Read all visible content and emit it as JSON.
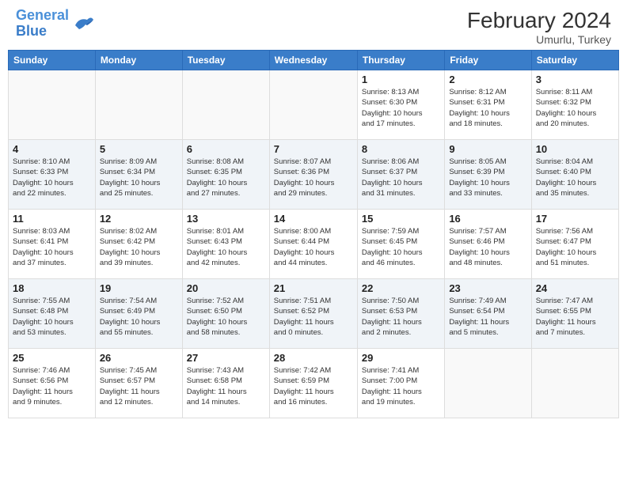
{
  "header": {
    "logo_line1": "General",
    "logo_line2": "Blue",
    "month": "February 2024",
    "location": "Umurlu, Turkey"
  },
  "days_of_week": [
    "Sunday",
    "Monday",
    "Tuesday",
    "Wednesday",
    "Thursday",
    "Friday",
    "Saturday"
  ],
  "weeks": [
    {
      "shaded": false,
      "days": [
        {
          "num": "",
          "info": ""
        },
        {
          "num": "",
          "info": ""
        },
        {
          "num": "",
          "info": ""
        },
        {
          "num": "",
          "info": ""
        },
        {
          "num": "1",
          "info": "Sunrise: 8:13 AM\nSunset: 6:30 PM\nDaylight: 10 hours\nand 17 minutes."
        },
        {
          "num": "2",
          "info": "Sunrise: 8:12 AM\nSunset: 6:31 PM\nDaylight: 10 hours\nand 18 minutes."
        },
        {
          "num": "3",
          "info": "Sunrise: 8:11 AM\nSunset: 6:32 PM\nDaylight: 10 hours\nand 20 minutes."
        }
      ]
    },
    {
      "shaded": true,
      "days": [
        {
          "num": "4",
          "info": "Sunrise: 8:10 AM\nSunset: 6:33 PM\nDaylight: 10 hours\nand 22 minutes."
        },
        {
          "num": "5",
          "info": "Sunrise: 8:09 AM\nSunset: 6:34 PM\nDaylight: 10 hours\nand 25 minutes."
        },
        {
          "num": "6",
          "info": "Sunrise: 8:08 AM\nSunset: 6:35 PM\nDaylight: 10 hours\nand 27 minutes."
        },
        {
          "num": "7",
          "info": "Sunrise: 8:07 AM\nSunset: 6:36 PM\nDaylight: 10 hours\nand 29 minutes."
        },
        {
          "num": "8",
          "info": "Sunrise: 8:06 AM\nSunset: 6:37 PM\nDaylight: 10 hours\nand 31 minutes."
        },
        {
          "num": "9",
          "info": "Sunrise: 8:05 AM\nSunset: 6:39 PM\nDaylight: 10 hours\nand 33 minutes."
        },
        {
          "num": "10",
          "info": "Sunrise: 8:04 AM\nSunset: 6:40 PM\nDaylight: 10 hours\nand 35 minutes."
        }
      ]
    },
    {
      "shaded": false,
      "days": [
        {
          "num": "11",
          "info": "Sunrise: 8:03 AM\nSunset: 6:41 PM\nDaylight: 10 hours\nand 37 minutes."
        },
        {
          "num": "12",
          "info": "Sunrise: 8:02 AM\nSunset: 6:42 PM\nDaylight: 10 hours\nand 39 minutes."
        },
        {
          "num": "13",
          "info": "Sunrise: 8:01 AM\nSunset: 6:43 PM\nDaylight: 10 hours\nand 42 minutes."
        },
        {
          "num": "14",
          "info": "Sunrise: 8:00 AM\nSunset: 6:44 PM\nDaylight: 10 hours\nand 44 minutes."
        },
        {
          "num": "15",
          "info": "Sunrise: 7:59 AM\nSunset: 6:45 PM\nDaylight: 10 hours\nand 46 minutes."
        },
        {
          "num": "16",
          "info": "Sunrise: 7:57 AM\nSunset: 6:46 PM\nDaylight: 10 hours\nand 48 minutes."
        },
        {
          "num": "17",
          "info": "Sunrise: 7:56 AM\nSunset: 6:47 PM\nDaylight: 10 hours\nand 51 minutes."
        }
      ]
    },
    {
      "shaded": true,
      "days": [
        {
          "num": "18",
          "info": "Sunrise: 7:55 AM\nSunset: 6:48 PM\nDaylight: 10 hours\nand 53 minutes."
        },
        {
          "num": "19",
          "info": "Sunrise: 7:54 AM\nSunset: 6:49 PM\nDaylight: 10 hours\nand 55 minutes."
        },
        {
          "num": "20",
          "info": "Sunrise: 7:52 AM\nSunset: 6:50 PM\nDaylight: 10 hours\nand 58 minutes."
        },
        {
          "num": "21",
          "info": "Sunrise: 7:51 AM\nSunset: 6:52 PM\nDaylight: 11 hours\nand 0 minutes."
        },
        {
          "num": "22",
          "info": "Sunrise: 7:50 AM\nSunset: 6:53 PM\nDaylight: 11 hours\nand 2 minutes."
        },
        {
          "num": "23",
          "info": "Sunrise: 7:49 AM\nSunset: 6:54 PM\nDaylight: 11 hours\nand 5 minutes."
        },
        {
          "num": "24",
          "info": "Sunrise: 7:47 AM\nSunset: 6:55 PM\nDaylight: 11 hours\nand 7 minutes."
        }
      ]
    },
    {
      "shaded": false,
      "days": [
        {
          "num": "25",
          "info": "Sunrise: 7:46 AM\nSunset: 6:56 PM\nDaylight: 11 hours\nand 9 minutes."
        },
        {
          "num": "26",
          "info": "Sunrise: 7:45 AM\nSunset: 6:57 PM\nDaylight: 11 hours\nand 12 minutes."
        },
        {
          "num": "27",
          "info": "Sunrise: 7:43 AM\nSunset: 6:58 PM\nDaylight: 11 hours\nand 14 minutes."
        },
        {
          "num": "28",
          "info": "Sunrise: 7:42 AM\nSunset: 6:59 PM\nDaylight: 11 hours\nand 16 minutes."
        },
        {
          "num": "29",
          "info": "Sunrise: 7:41 AM\nSunset: 7:00 PM\nDaylight: 11 hours\nand 19 minutes."
        },
        {
          "num": "",
          "info": ""
        },
        {
          "num": "",
          "info": ""
        }
      ]
    }
  ]
}
